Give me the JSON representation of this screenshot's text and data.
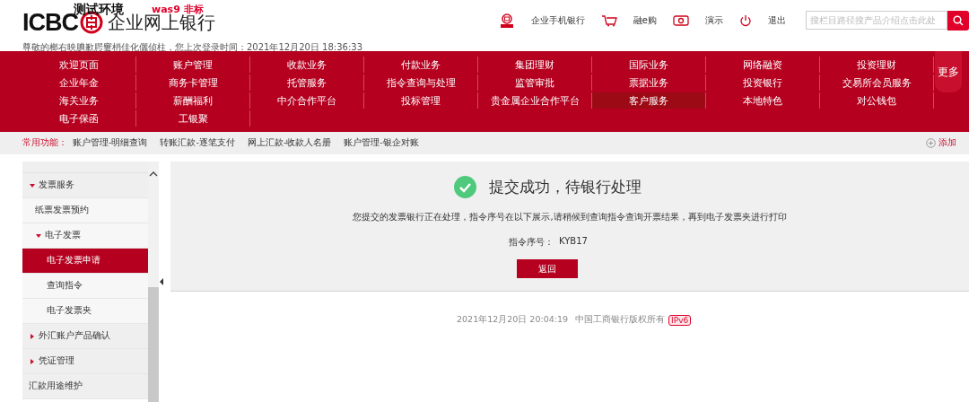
{
  "header": {
    "logo_text": "ICBC",
    "bank_name": "企业网上银行",
    "env_label": "测试环境",
    "server_label": "was9 非标",
    "welcome": "尊敬的榔右映腆歉腭窶梢佳化儷侦柱，您上次登录时间：2021年12月20日 18:36:33",
    "links": [
      {
        "kind": "mobile",
        "label": "企业手机银行"
      },
      {
        "kind": "shop",
        "label": "融e购"
      },
      {
        "kind": "demo",
        "label": "演示"
      },
      {
        "kind": "logout",
        "label": "退出"
      }
    ],
    "search": {
      "placeholder": "搜栏目路径搜产品介绍点击此处"
    }
  },
  "nav": {
    "items": [
      {
        "label": "欢迎页面",
        "selected": false
      },
      {
        "label": "账户管理",
        "selected": false
      },
      {
        "label": "收款业务",
        "selected": false
      },
      {
        "label": "付款业务",
        "selected": false
      },
      {
        "label": "集团理财",
        "selected": false
      },
      {
        "label": "国际业务",
        "selected": false
      },
      {
        "label": "网络融资",
        "selected": false
      },
      {
        "label": "投资理财",
        "selected": false
      },
      {
        "label": "企业年金",
        "selected": false
      },
      {
        "label": "商务卡管理",
        "selected": false
      },
      {
        "label": "托管服务",
        "selected": false
      },
      {
        "label": "指令查询与处理",
        "selected": false
      },
      {
        "label": "监管审批",
        "selected": false
      },
      {
        "label": "票据业务",
        "selected": false
      },
      {
        "label": "投资银行",
        "selected": false
      },
      {
        "label": "交易所会员服务",
        "selected": false
      },
      {
        "label": "海关业务",
        "selected": false
      },
      {
        "label": "薪酬福利",
        "selected": false
      },
      {
        "label": "中介合作平台",
        "selected": false
      },
      {
        "label": "投标管理",
        "selected": false
      },
      {
        "label": "贵金属企业合作平台",
        "selected": false
      },
      {
        "label": "客户服务",
        "selected": true
      },
      {
        "label": "本地特色",
        "selected": false
      },
      {
        "label": "对公钱包",
        "selected": false
      },
      {
        "label": "电子保函",
        "selected": false
      },
      {
        "label": "工银聚",
        "selected": false
      }
    ],
    "more": "更多"
  },
  "quick_bar": {
    "label": "常用功能：",
    "links": [
      "账户管理-明细查询",
      "转账汇款-逐笔支付",
      "网上汇款-收款人名册",
      "账户管理-银企对账"
    ],
    "add": "添加"
  },
  "sidebar": {
    "items": [
      {
        "label": "发票服务",
        "selected": false,
        "expanded": true,
        "children": [
          {
            "label": "纸票发票预约",
            "selected": false
          },
          {
            "label": "电子发票",
            "selected": false,
            "expanded": true,
            "children": [
              {
                "label": "电子发票申请",
                "selected": true
              },
              {
                "label": "查询指令",
                "selected": false
              },
              {
                "label": "电子发票夹",
                "selected": false
              }
            ]
          }
        ]
      },
      {
        "label": "外汇账户产品确认",
        "selected": false,
        "expanded": false
      },
      {
        "label": "凭证管理",
        "selected": false,
        "expanded": false
      },
      {
        "label": "汇款用途维护",
        "selected": false
      }
    ]
  },
  "result": {
    "title": "提交成功，待银行处理",
    "message": "您提交的发票银行正在处理，指令序号在以下展示,请稍候到查询指令查询开票结果，再到电子发票夹进行打印",
    "serial_label": "指令序号：",
    "serial_value": "KYB17",
    "back_button": "返回"
  },
  "footer": {
    "timestamp": "2021年12月20日 20:04:19",
    "copyright": "中国工商银行版权所有",
    "badge": "IPv6"
  }
}
